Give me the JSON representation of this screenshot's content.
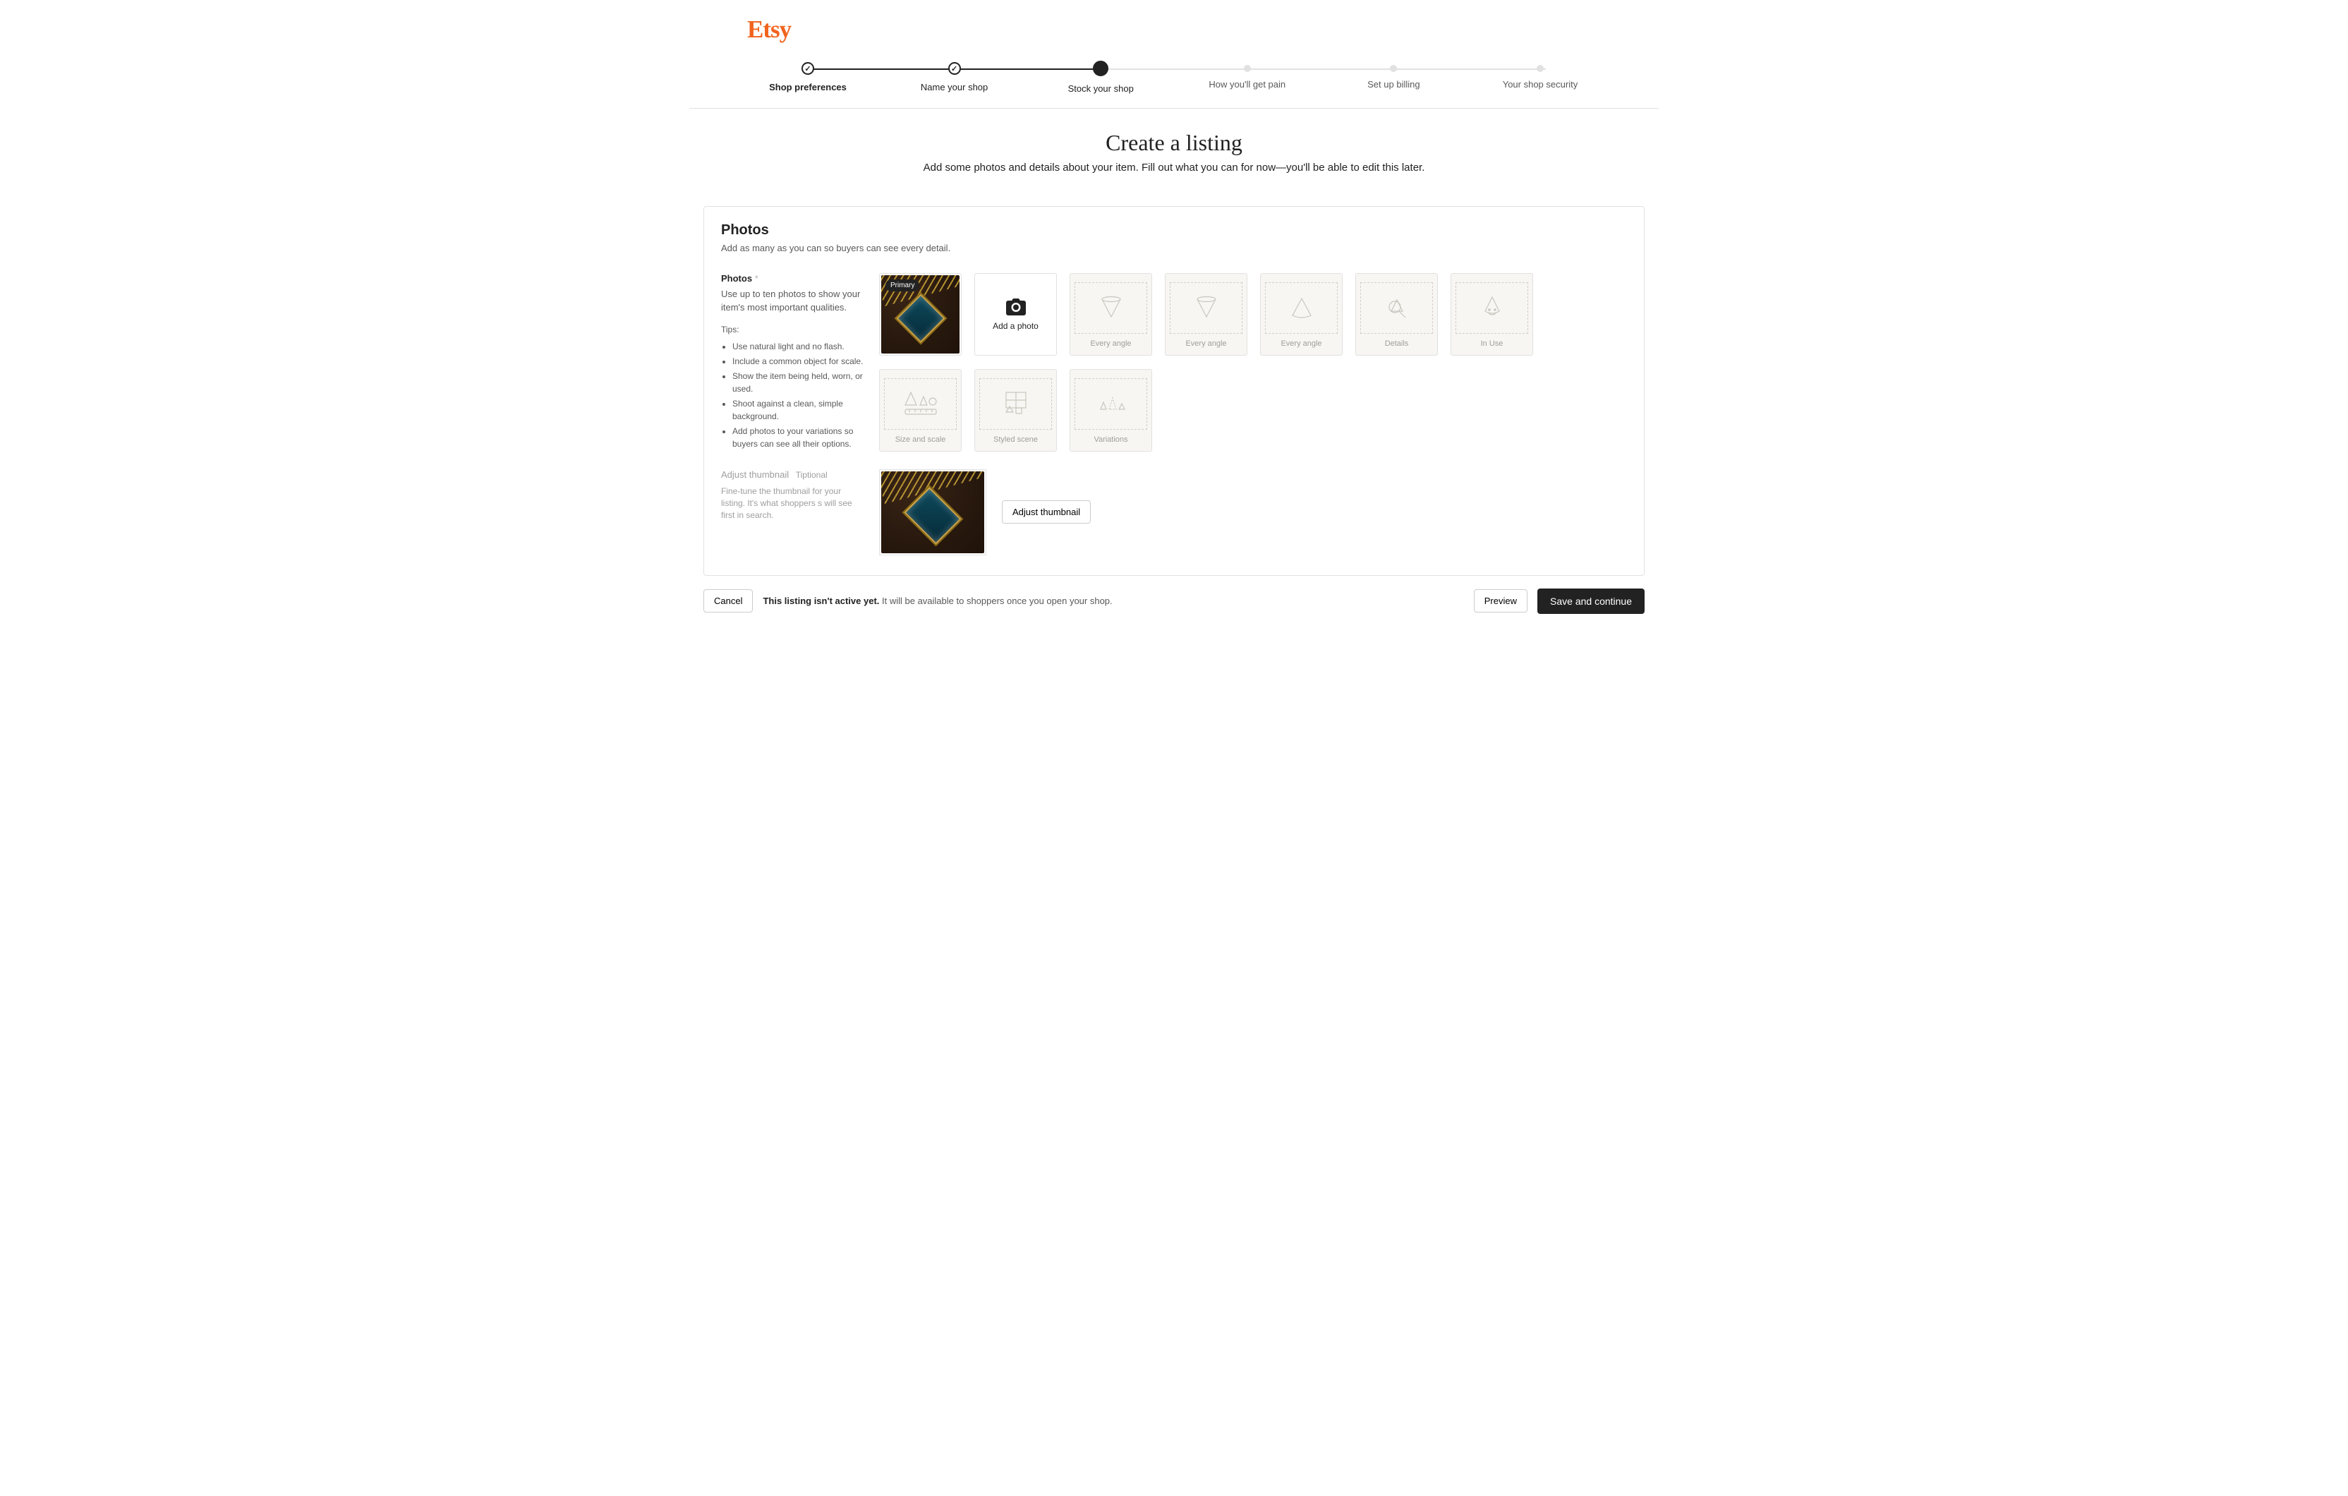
{
  "logo": "Etsy",
  "stepper": {
    "steps": [
      {
        "label": "Shop preferences",
        "state": "done"
      },
      {
        "label": "Name your shop",
        "state": "done"
      },
      {
        "label": "Stock your shop",
        "state": "current"
      },
      {
        "label": "How you'll get pain",
        "state": "pending"
      },
      {
        "label": "Set up billing",
        "state": "pending"
      },
      {
        "label": "Your shop security",
        "state": "pending"
      }
    ]
  },
  "heading": {
    "title": "Create a listing",
    "subtitle": "Add some photos and details about your item. Fill out what you can for now—you'll be able to edit this later."
  },
  "photos_section": {
    "title": "Photos",
    "subtitle": "Add as many as you can so buyers can see every detail.",
    "field_label": "Photos",
    "required_mark": "*",
    "field_desc": "Use up to ten photos to show your item's most important qualities.",
    "tips_label": "Tips:",
    "tips": [
      "Use natural light and no flash.",
      "Include a common object for scale.",
      "Show the item being held, worn, or used.",
      "Shoot against a clean, simple background.",
      "Add photos to your variations so buyers can see all their options."
    ],
    "primary_badge": "Primary",
    "add_photo_label": "Add a photo",
    "slots": [
      {
        "label": "Every angle",
        "type": "angle1"
      },
      {
        "label": "Every angle",
        "type": "angle2"
      },
      {
        "label": "Every angle",
        "type": "angle3"
      },
      {
        "label": "Details",
        "type": "details"
      },
      {
        "label": "In Use",
        "type": "inuse"
      },
      {
        "label": "Size and scale",
        "type": "scale"
      },
      {
        "label": "Styled scene",
        "type": "scene"
      },
      {
        "label": "Variations",
        "type": "variations"
      }
    ]
  },
  "thumbnail_section": {
    "label": "Adjust thumbnail",
    "optional": "Tiptional",
    "desc": "Fine-tune the thumbnail for your listing. It's what shoppers s will see first in search.",
    "button": "Adjust thumbnail"
  },
  "footer": {
    "cancel": "Cancel",
    "status_bold": "This listing isn't active yet.",
    "status_rest": " It will be available to shoppers once you open your shop.",
    "preview": "Preview",
    "save": "Save and continue"
  }
}
